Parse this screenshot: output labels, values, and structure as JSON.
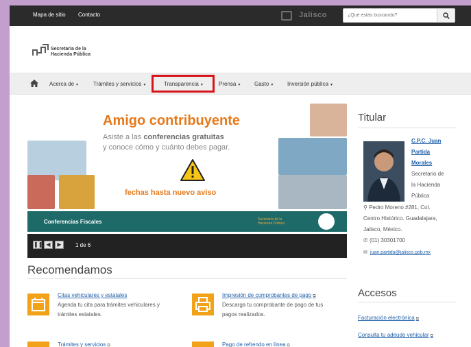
{
  "topbar": {
    "links": [
      "Mapa de sitio",
      "Contacto"
    ],
    "logo_text": "Jalisco",
    "search_placeholder": "¿Qué estás buscando?"
  },
  "brand": {
    "line1": "Secretaría de la",
    "line2": "Hacienda Pública"
  },
  "nav": {
    "items": [
      {
        "label": "Acerca de"
      },
      {
        "label": "Trámites y servicios"
      },
      {
        "label": "Transparencia"
      },
      {
        "label": "Prensa"
      },
      {
        "label": "Gasto"
      },
      {
        "label": "Inversión pública"
      }
    ]
  },
  "slide": {
    "title": "Amigo contribuyente",
    "sub1_pre": "Asiste a las ",
    "sub1_bold": "conferencias gratuitas",
    "sub2": "y conoce cómo y cuánto debes pagar.",
    "dates": "fechas hasta nuevo aviso",
    "caption": "Conferencias Fiscales",
    "mini_line1": "Secretaría de la",
    "mini_line2": "Hacienda Pública",
    "counter": "1 de 6"
  },
  "titular": {
    "heading": "Titular",
    "name_lines": [
      "C.P.C. Juan",
      "Partida",
      "Morales"
    ],
    "role_lines": [
      "Secretario de",
      "la Hacienda",
      "Pública"
    ],
    "address_lines": [
      "Pedro Moreno #281, Col.",
      "Centro Histórico. Guadalajara,",
      "Jalisco, México."
    ],
    "phone": "(01) 30301700",
    "email": "juan.partida@jalisco.gob.mx"
  },
  "recomendamos": {
    "heading": "Recomendamos",
    "items": [
      {
        "title": "Citas vehiculares y estatales",
        "desc": [
          "Agenda tu cita para trámites vehiculares y",
          "trámites estatales."
        ]
      },
      {
        "title": "Impresión de comprobantes de pago",
        "desc": [
          "Descarga tu comprobante de pago de tus",
          "pagos realizados."
        ]
      },
      {
        "title": "Trámites y servicios",
        "desc": []
      },
      {
        "title": "Pago de refrendo en línea",
        "desc": []
      }
    ]
  },
  "accesos": {
    "heading": "Accesos",
    "links": [
      "Facturación electrónica",
      "Consulta tu adeudo vehicular"
    ]
  },
  "colors": {
    "accent": "#e5791b",
    "teal": "#1e6a68",
    "link": "#1f5fa8",
    "highlight": "#d6141a",
    "icon_bg": "#f2a219"
  }
}
